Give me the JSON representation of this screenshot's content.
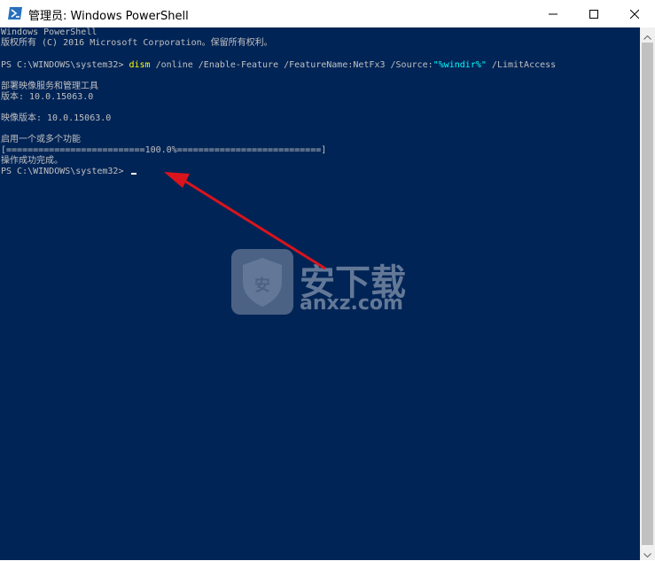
{
  "window": {
    "title": "管理员: Windows PowerShell",
    "icon": "powershell-icon",
    "controls": [
      "minimize-icon",
      "maximize-icon",
      "close-icon"
    ]
  },
  "console": {
    "header_line1": "Windows PowerShell",
    "header_line2": "版权所有 (C) 2016 Microsoft Corporation。保留所有权利。",
    "prompt": "PS C:\\WINDOWS\\system32> ",
    "command": {
      "name": "dism",
      "args": " /online /Enable-Feature /FeatureName:NetFx3 /Source:",
      "source_value": "\"%windir%\"",
      "tail": " /LimitAccess"
    },
    "tool_name": "部署映像服务和管理工具",
    "tool_version": "版本: 10.0.15063.0",
    "image_version": "映像版本: 10.0.15063.0",
    "enable_features": "启用一个或多个功能",
    "progress_left": "[==========================",
    "progress_percent": "100.0%",
    "progress_right": "===========================]",
    "progress_value": 100,
    "success": "操作成功完成。",
    "prompt2": "PS C:\\WINDOWS\\system32> "
  },
  "annotation": {
    "arrow_color": "#d9141c"
  },
  "watermark": {
    "text": "安下载",
    "url": "anxz.com",
    "icon": "shield-logo-icon"
  },
  "colors": {
    "console_bg": "#012456",
    "console_fg": "#c0c0c0",
    "command_yellow": "#ffff00",
    "string_cyan": "#00ffff"
  }
}
